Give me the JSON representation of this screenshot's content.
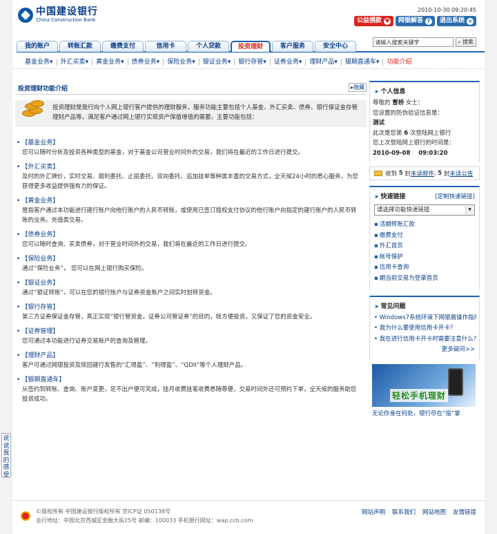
{
  "header": {
    "bank_cn": "中国建设银行",
    "bank_en": "China Construction Bank",
    "datetime": "2010-10-30 09:20:45",
    "buttons": [
      "公益捐款",
      "网银解答",
      "退出系统"
    ]
  },
  "nav": {
    "tabs": [
      "我的账户",
      "转账汇款",
      "缴费支付",
      "信用卡",
      "个人贷款",
      "投资理财",
      "客户服务",
      "安全中心"
    ],
    "active_index": 5
  },
  "search": {
    "placeholder": "请输入搜索关键字",
    "value": "请输入搜索关键字",
    "button": "搜索"
  },
  "subnav": [
    "基金业务",
    "外汇买卖",
    "黄金业务",
    "债券业务",
    "保险业务",
    "银证业务",
    "银行存管",
    "证券业务",
    "理财产品",
    "银期直通车",
    "功能介绍"
  ],
  "main": {
    "title": "投资理财功能介绍",
    "hide": "隐藏",
    "intro": "投资理财是我行向个人网上银行客户提供的理财服务，服务功能主要包括个人基金、外汇买卖、债券、银行保证金存管理财产品等，满足客户通过网上银行实现资产保值增值的需要。主要功能包括：",
    "sections": [
      {
        "title": "【基金业务】",
        "desc": "您可以随时分析及投资各种类型的基金，对于基金公司营业时间外的交易，我们将在最近的工作日进行提交。"
      },
      {
        "title": "【外汇买卖】",
        "desc": "及时的外汇牌价，实时交易、葫利委托、止损委托、双向委托、追加挂单等种类丰富的交易方式，全天候24小时的悉心服务，为您获得更多收益提供强有力的保证。"
      },
      {
        "title": "【黄金业务】",
        "desc": "是指客户通过本功能进行建行账户向他行账户的人民币转账，或使用已签订授权支付协议的他行账户向指定的建行账户的人民币转账的业务。充值类交易。"
      },
      {
        "title": "【债券业务】",
        "desc": "您可以随时查询、买卖债券，对于营业时间外的交易，我们将在最近的工作日进行提交。"
      },
      {
        "title": "【保险业务】",
        "desc": "通过“保险业务”， 您可以在网上银行购买保险。"
      },
      {
        "title": "【银证业务】",
        "desc": "通过“银证转账”，可以在您的银行账户与证券资金账户之间实时划转资金。"
      },
      {
        "title": "【银行存管】",
        "desc": "第三方证券保证金存管，真正实现“银行管资金，证券公司管证券”的目的，既方便投资，又保证了您的资金安全。"
      },
      {
        "title": "【证券管理】",
        "desc": "您可通过本功能进行证券交易账户的查询及管理。"
      },
      {
        "title": "【理财产品】",
        "desc": "客户可通过网银投资及赎回建行发售的“汇得盈”、“利得盈”、“QDII”等个人理财产品。"
      },
      {
        "title": "【银期直通车】",
        "desc": "从签约到转账、查询、账户变更，足不出户便可完成，挂月收费挂笔收费悉随尊便，交易时间外还可预约下单，全天候的服务助您投资成功。"
      }
    ]
  },
  "sidebar": {
    "personal": {
      "title": "个人信息",
      "line1_a": "尊敬的",
      "line1_name": "曹桥",
      "line1_b": "女士：",
      "line2": "您设置的防伪验证信息是：",
      "line3": "测试",
      "line4_a": "此次是您第",
      "line4_n": "6",
      "line4_b": "次登陆网上银行",
      "line5": "您上次登陆网上银行的时间是：",
      "line6": "2010-09-08    09:03:20"
    },
    "mail": {
      "a": "收到",
      "n1": "5",
      "b": "封",
      "link1": "未读邮件",
      "c": ",",
      "n2": "5",
      "d": "封",
      "link2": "未读公告"
    },
    "quick": {
      "title": "快速链接",
      "custom": "[定制快速链接]",
      "select": "请选择功能快速链接",
      "items": [
        "活期转账汇款",
        "缴费支付",
        "外汇首页",
        "帐号保护",
        "信用卡查询",
        "期当前交易为登录首页"
      ]
    },
    "faq": {
      "title": "常见问题",
      "items": [
        "Windows7系统环境下网银盾操作指南",
        "我为什么要使用信用卡开卡？",
        "我在进行信用卡开卡时需要注意什么？"
      ],
      "more": "更多疑问>>"
    },
    "banner": {
      "slogan": "轻松手机理财",
      "caption": "无论你身在何处，银行尽在“指”掌"
    }
  },
  "footer": {
    "line1": "©版权所有 中国建设银行版权所有 京ICP证 050138号",
    "line2": "总行地址：中国北京西城区金融大街25号 邮编：100033 手机银行网址：wap.ccb.com",
    "links": [
      "网站声明",
      "联系我们",
      "网站地图",
      "友情链接"
    ]
  },
  "feedback": "说说我的感受"
}
